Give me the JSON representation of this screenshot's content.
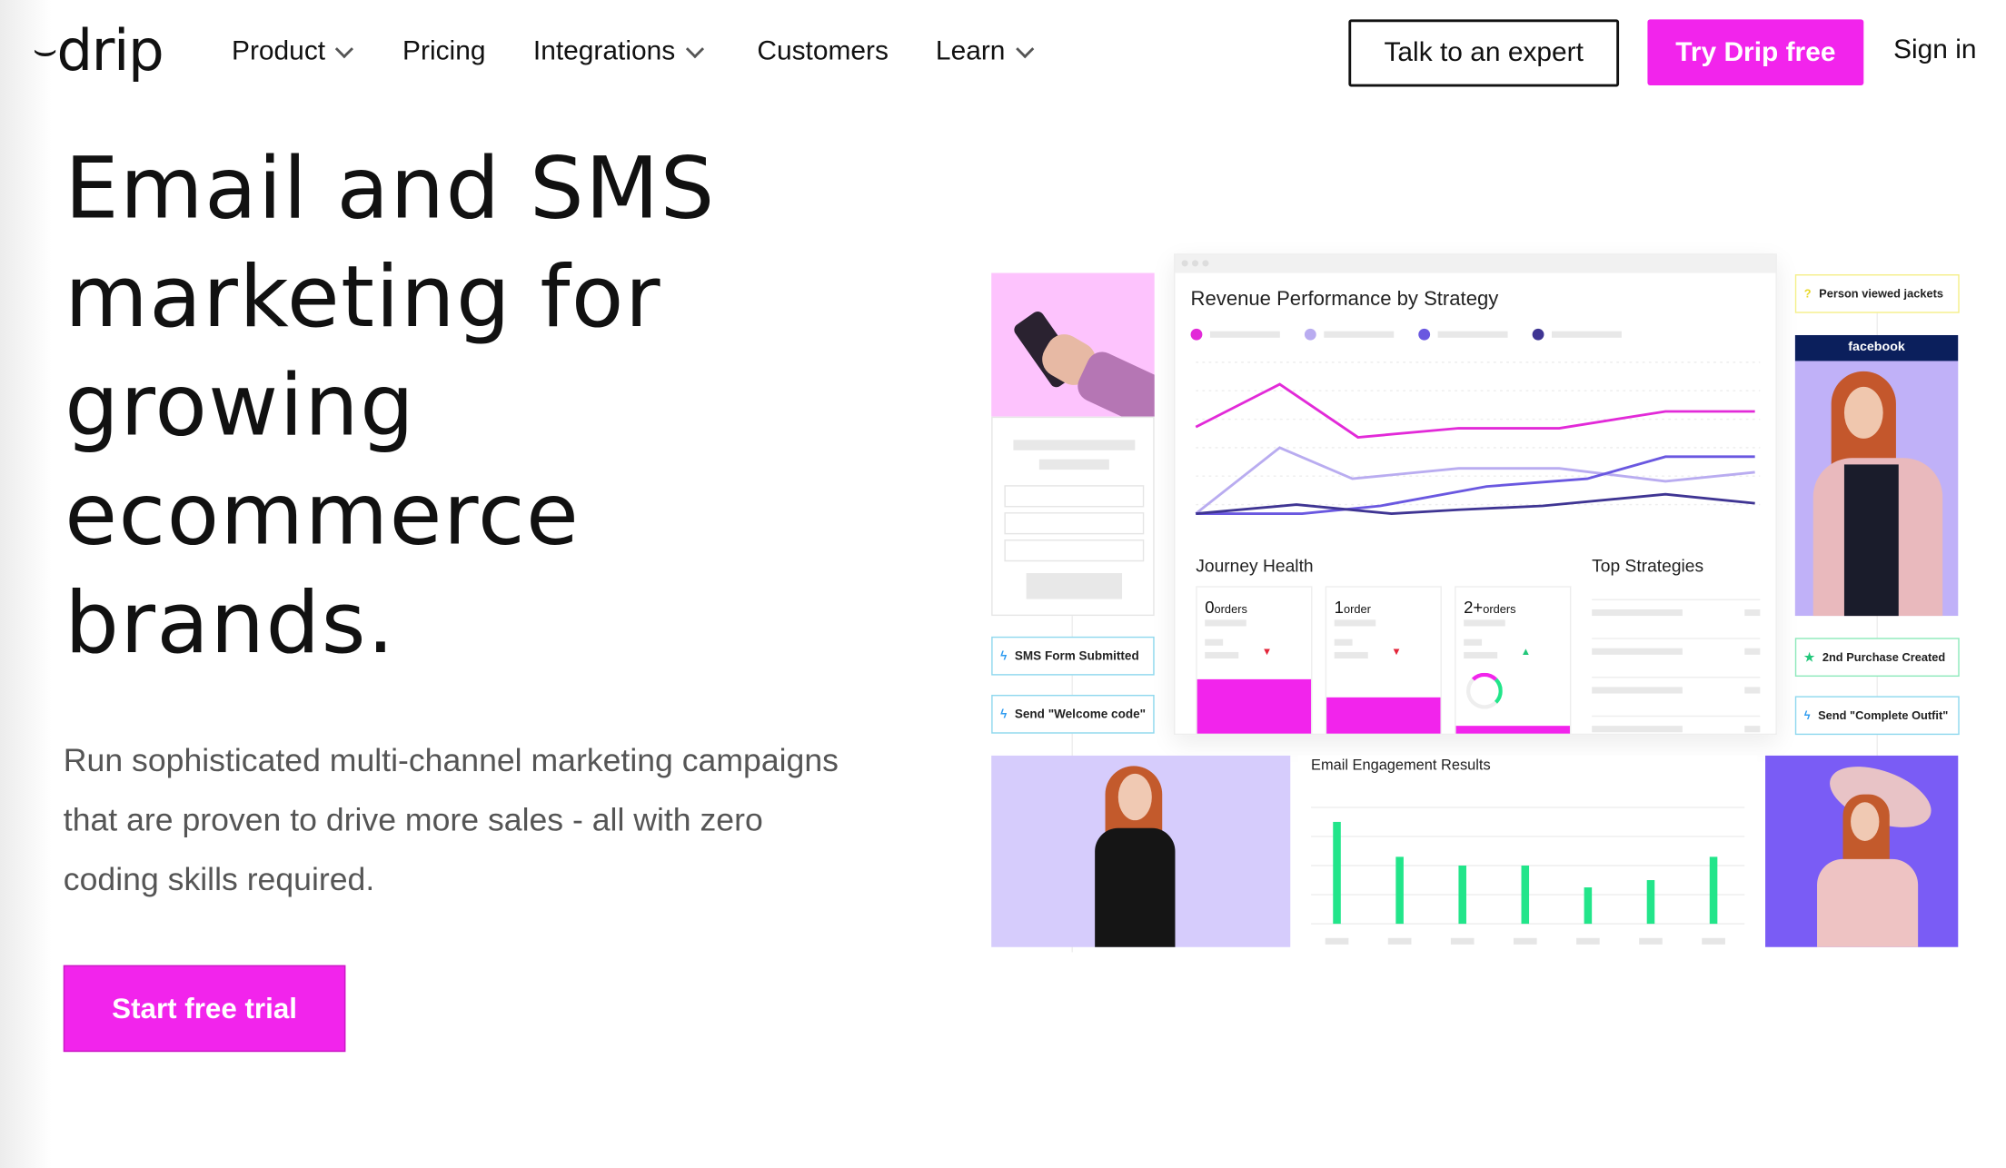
{
  "nav": {
    "logo": "drip",
    "items": [
      {
        "label": "Product",
        "has_dropdown": true
      },
      {
        "label": "Pricing",
        "has_dropdown": false
      },
      {
        "label": "Integrations",
        "has_dropdown": true
      },
      {
        "label": "Customers",
        "has_dropdown": false
      },
      {
        "label": "Learn",
        "has_dropdown": true
      }
    ],
    "talk_label": "Talk to an expert",
    "try_label": "Try Drip free",
    "signin_label": "Sign in"
  },
  "hero": {
    "headline_lines": [
      "Email and SMS",
      "marketing for",
      "growing",
      "ecommerce",
      "brands."
    ],
    "subtext": "Run sophisticated multi-channel marketing campaigns that are proven to drive more sales - all with zero coding skills required.",
    "cta_label": "Start free trial"
  },
  "colors": {
    "brand": "#f224ec",
    "green": "#22e58a",
    "navy": "#0b1f5c",
    "lavender": "#d6ccfc",
    "purple": "#7a5cf5",
    "pink": "#fdc3fd"
  },
  "dashboard": {
    "left_pills": [
      {
        "icon": "bolt-icon",
        "label": "SMS Form Submitted"
      },
      {
        "icon": "bolt-icon",
        "label": "Send \"Welcome code\""
      }
    ],
    "right_pills": [
      {
        "icon": "question-icon",
        "label": "Person viewed jackets"
      },
      {
        "icon": "star-icon",
        "label": "2nd Purchase Created"
      },
      {
        "icon": "bolt-icon",
        "label": "Send \"Complete Outfit\""
      }
    ],
    "facebook_label": "facebook",
    "journey_title": "Journey Health",
    "top_strategies_title": "Top Strategies",
    "journey_cards": [
      {
        "count": "0",
        "unit": "orders",
        "trend": "down",
        "fill_pct": 37
      },
      {
        "count": "1",
        "unit": "order",
        "trend": "down",
        "fill_pct": 25
      },
      {
        "count": "2+",
        "unit": "orders",
        "trend": "up",
        "fill_pct": 5
      }
    ]
  },
  "chart_data": [
    {
      "type": "line",
      "title": "Revenue Performance by Strategy",
      "ylim": [
        0,
        110
      ],
      "xlim": [
        0,
        100
      ],
      "grid": true,
      "legend": "top-left",
      "series": [
        {
          "color": "#e22ad8",
          "points": [
            [
              0,
              67
            ],
            [
              15,
              100
            ],
            [
              29,
              59
            ],
            [
              47,
              66
            ],
            [
              65,
              66
            ],
            [
              84,
              79
            ],
            [
              100,
              79
            ]
          ]
        },
        {
          "color": "#b9acf0",
          "points": [
            [
              0,
              0
            ],
            [
              15,
              51
            ],
            [
              28,
              27
            ],
            [
              47,
              35
            ],
            [
              65,
              35
            ],
            [
              84,
              25
            ],
            [
              100,
              32
            ]
          ]
        },
        {
          "color": "#6a58e0",
          "points": [
            [
              0,
              0
            ],
            [
              19,
              0
            ],
            [
              33,
              6
            ],
            [
              52,
              21
            ],
            [
              70,
              27
            ],
            [
              84,
              44
            ],
            [
              100,
              44
            ]
          ]
        },
        {
          "color": "#3f3593",
          "points": [
            [
              0,
              0
            ],
            [
              18,
              7
            ],
            [
              35,
              0
            ],
            [
              47,
              3
            ],
            [
              62,
              6
            ],
            [
              84,
              15
            ],
            [
              100,
              8
            ]
          ]
        }
      ]
    },
    {
      "type": "bar",
      "title": "Email Engagement Results",
      "ylim": [
        0,
        4
      ],
      "grid": true,
      "values": [
        3.5,
        2.3,
        2.0,
        2.0,
        1.25,
        1.5,
        2.3
      ],
      "color": "#22e58a"
    }
  ]
}
